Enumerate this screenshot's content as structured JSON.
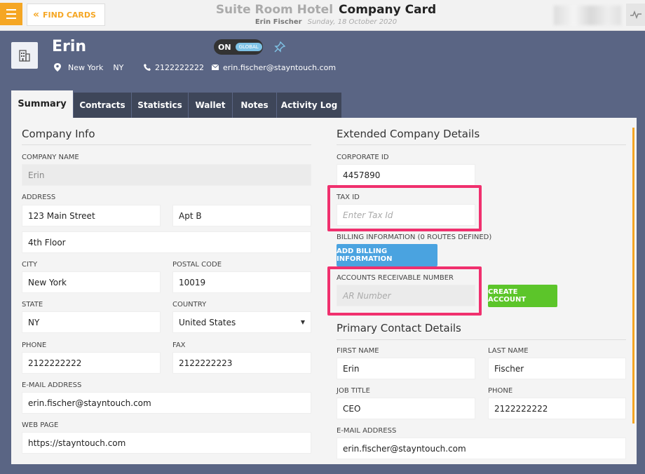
{
  "topbar": {
    "find_cards_label": "FIND CARDS",
    "hotel_name": "Suite Room Hotel",
    "page_title": "Company Card",
    "user_name": "Erin Fischer",
    "date": "Sunday, 18 October 2020"
  },
  "header": {
    "company_name": "Erin",
    "toggle_on": "ON",
    "toggle_global": "GLOBAL",
    "city": "New York",
    "state": "NY",
    "phone": "2122222222",
    "email": "erin.fischer@stayntouch.com"
  },
  "tabs": [
    "Summary",
    "Contracts",
    "Statistics",
    "Wallet",
    "Notes",
    "Activity Log"
  ],
  "company_info": {
    "title": "Company Info",
    "company_name_label": "COMPANY NAME",
    "company_name_value": "Erin",
    "address_label": "ADDRESS",
    "address_line1": "123 Main Street",
    "address_line2": "Apt B",
    "address_line3": "4th Floor",
    "city_label": "CITY",
    "city_value": "New York",
    "postal_label": "POSTAL CODE",
    "postal_value": "10019",
    "state_label": "STATE",
    "state_value": "NY",
    "country_label": "COUNTRY",
    "country_value": "United States",
    "phone_label": "PHONE",
    "phone_value": "2122222222",
    "fax_label": "FAX",
    "fax_value": "2122222223",
    "email_label": "E-MAIL ADDRESS",
    "email_value": "erin.fischer@stayntouch.com",
    "web_label": "WEB PAGE",
    "web_value": "https://stayntouch.com"
  },
  "extended": {
    "title": "Extended Company Details",
    "corporate_id_label": "CORPORATE ID",
    "corporate_id_value": "4457890",
    "tax_id_label": "TAX ID",
    "tax_id_placeholder": "Enter Tax Id",
    "billing_label": "BILLING INFORMATION (0 ROUTES DEFINED)",
    "billing_button": "ADD BILLING INFORMATION",
    "ar_label": "ACCOUNTS RECEIVABLE NUMBER",
    "ar_placeholder": "AR Number",
    "create_account_button": "CREATE ACCOUNT"
  },
  "primary_contact": {
    "title": "Primary Contact Details",
    "first_name_label": "FIRST NAME",
    "first_name_value": "Erin",
    "last_name_label": "LAST NAME",
    "last_name_value": "Fischer",
    "job_title_label": "JOB TITLE",
    "job_title_value": "CEO",
    "phone_label": "PHONE",
    "phone_value": "2122222222",
    "email_label": "E-MAIL ADDRESS",
    "email_value": "erin.fischer@stayntouch.com"
  },
  "colors": {
    "accent": "#f5a623",
    "highlight": "#f0306e",
    "header_bg": "#5a6584",
    "tab_bg": "#3e4659",
    "blue_button": "#4aa3e0",
    "green_button": "#5cc52a"
  },
  "icons": [
    "menu-icon",
    "double-chevron-left-icon",
    "activity-icon",
    "building-icon",
    "pin-icon",
    "location-icon",
    "phone-icon",
    "mail-icon",
    "caret-down-icon"
  ]
}
